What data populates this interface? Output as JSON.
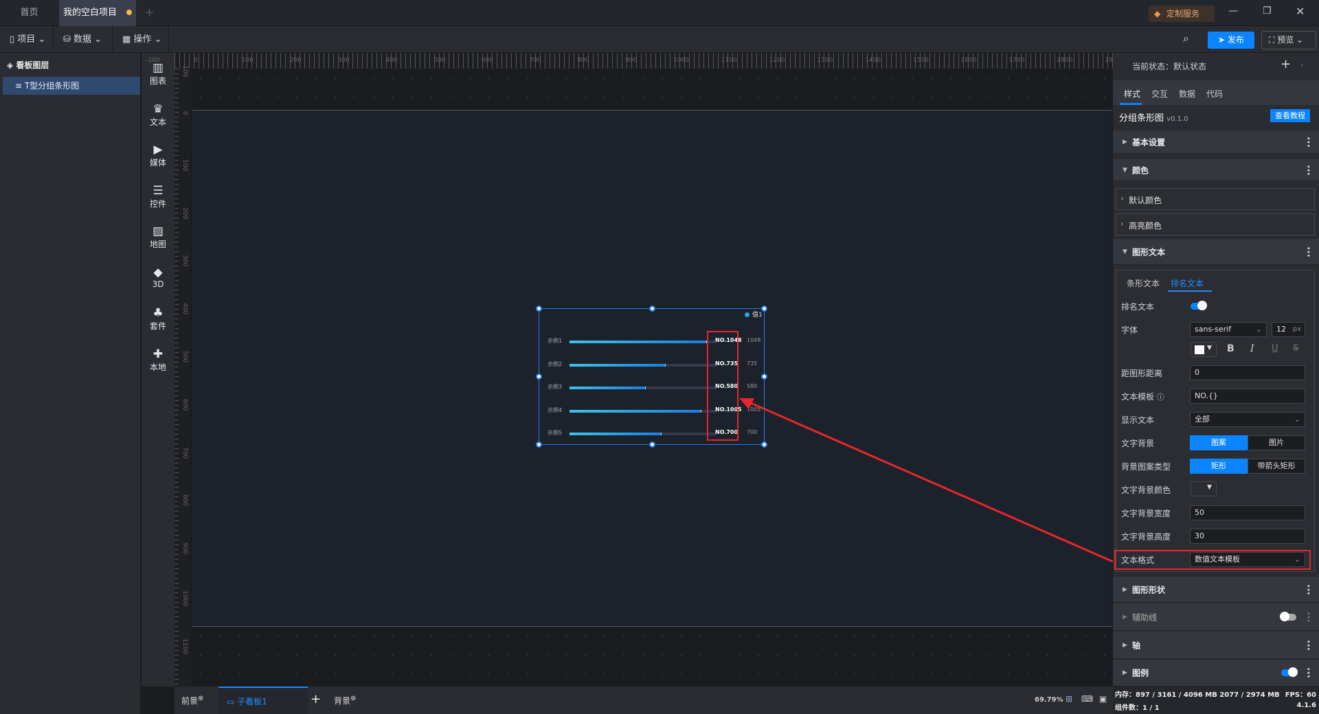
{
  "titlebar": {
    "tabs": [
      {
        "label": "首页"
      },
      {
        "label": "我的空白项目"
      }
    ],
    "custom_service": "定制服务"
  },
  "toolbar": {
    "project": "项目",
    "data": "数据",
    "operate": "操作",
    "publish": "发布",
    "preview": "预览"
  },
  "layers": {
    "title": "看板图层",
    "items": [
      {
        "label": "T型分组条形图"
      }
    ]
  },
  "components": [
    {
      "icon": "bar-chart-icon",
      "glyph": "▥",
      "label": "图表"
    },
    {
      "icon": "crown-icon",
      "glyph": "♛",
      "label": "文本"
    },
    {
      "icon": "camera-icon",
      "glyph": "▶",
      "label": "媒体"
    },
    {
      "icon": "list-icon",
      "glyph": "☰",
      "label": "控件"
    },
    {
      "icon": "map-icon",
      "glyph": "▨",
      "label": "地图"
    },
    {
      "icon": "cube-icon",
      "glyph": "◆",
      "label": "3D"
    },
    {
      "icon": "shirt-icon",
      "glyph": "♣",
      "label": "套件"
    },
    {
      "icon": "puzzle-icon",
      "glyph": "✚",
      "label": "本地"
    }
  ],
  "ruler": {
    "top": [
      "-100",
      "0",
      "100",
      "200",
      "300",
      "400",
      "500",
      "600",
      "700",
      "800",
      "900",
      "1000",
      "1100",
      "1200",
      "1300",
      "1400",
      "1500",
      "1600",
      "1700",
      "1800",
      "1900"
    ],
    "left": [
      "-100",
      "0",
      "100",
      "200",
      "300",
      "400",
      "500",
      "600",
      "700",
      "800",
      "900",
      "1000",
      "1100"
    ]
  },
  "chart_data": {
    "type": "bar",
    "orientation": "horizontal",
    "categories": [
      "示例1",
      "示例2",
      "示例3",
      "示例4",
      "示例5"
    ],
    "series": [
      {
        "name": "值1",
        "values": [
          1048,
          735,
          580,
          1005,
          700
        ]
      }
    ],
    "rank_labels": [
      "NO.1048",
      "NO.735",
      "NO.580",
      "NO.1005",
      "NO.700"
    ],
    "xlim": [
      0,
      1120
    ],
    "legend": "top-right",
    "colors": {
      "bar_start": "#3ec3ea",
      "bar_end": "#1a7fe0",
      "track": "#353a4a"
    }
  },
  "bottom": {
    "foreground": "前景",
    "subboard": "子看板1",
    "background": "背景",
    "zoom": "69.79%"
  },
  "panel": {
    "state": "当前状态：默认状态",
    "tabs": [
      "样式",
      "交互",
      "数据",
      "代码"
    ],
    "component_name": "分组条形图",
    "version": "v0.1.0",
    "tutorial": "查看教程",
    "sections": {
      "basic": "基本设置",
      "color": "颜色",
      "default_color": "默认颜色",
      "highlight_color": "高亮颜色",
      "shape_text": "图形文本",
      "shape": "图形形状",
      "guide": "辅助线",
      "axis": "轴",
      "legend": "图例"
    },
    "subtabs": [
      "条形文本",
      "排名文本"
    ],
    "fields": {
      "rank_text": "排名文本",
      "font": "字体",
      "font_value": "sans-serif",
      "font_size": "12",
      "unit": "px",
      "distance": "距图形距离",
      "distance_value": "0",
      "template": "文本模板",
      "template_value": "NO.{}",
      "show_text": "显示文本",
      "show_text_value": "全部",
      "text_bg": "文字背景",
      "text_bg_opts": [
        "图案",
        "图片"
      ],
      "bg_type": "背景图案类型",
      "bg_type_opts": [
        "矩形",
        "带箭头矩形"
      ],
      "bg_color": "文字背景颜色",
      "bg_width": "文字背景宽度",
      "bg_width_value": "50",
      "bg_height": "文字背景高度",
      "bg_height_value": "30",
      "format": "文本格式",
      "format_value": "数值文本模板"
    }
  },
  "status": {
    "memory": "内存：897 / 3161 / 4096 MB  2077 / 2974 MB",
    "fps": "FPS：60",
    "count": "组件数：1 / 1",
    "version": "4.1.6"
  },
  "colors": {
    "accent": "#0a84ff",
    "highlight": "#e8262b"
  }
}
